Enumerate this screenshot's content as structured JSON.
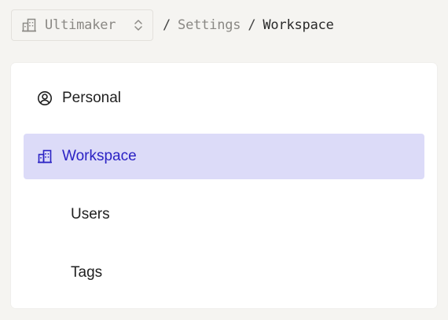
{
  "breadcrumb": {
    "org_icon": "building-icon",
    "org_name": "Ultimaker",
    "switch_icon": "chevron-up-down-icon",
    "separator": "/",
    "settings": "Settings",
    "current": "Workspace"
  },
  "nav": {
    "personal": {
      "label": "Personal",
      "icon": "user-circle-icon"
    },
    "workspace": {
      "label": "Workspace",
      "icon": "building-icon",
      "active": true
    },
    "users": {
      "label": "Users"
    },
    "tags": {
      "label": "Tags"
    }
  },
  "colors": {
    "active_bg": "#dcdbf8",
    "active_text": "#2b22c4",
    "page_bg": "#f5f4f1"
  }
}
